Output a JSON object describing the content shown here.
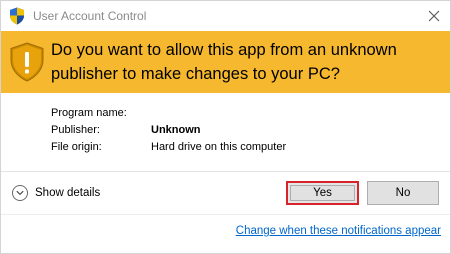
{
  "window": {
    "title": "User Account Control"
  },
  "banner": {
    "message": "Do you want to allow this app from an unknown publisher to make changes to your PC?",
    "color": "#f5b82e"
  },
  "details": {
    "program_name_label": "Program name:",
    "program_name_value": "",
    "publisher_label": "Publisher:",
    "publisher_value": "Unknown",
    "file_origin_label": "File origin:",
    "file_origin_value": "Hard drive on this computer"
  },
  "actions": {
    "show_details_label": "Show details",
    "yes_label": "Yes",
    "no_label": "No",
    "highlight_color": "#d9232c"
  },
  "footer": {
    "notifications_link": "Change when these notifications appear",
    "link_color": "#0066cc"
  },
  "icons": {
    "title": "uac-shield-icon",
    "banner": "warning-shield-icon",
    "close": "close-icon",
    "details_toggle": "chevron-down-icon"
  }
}
